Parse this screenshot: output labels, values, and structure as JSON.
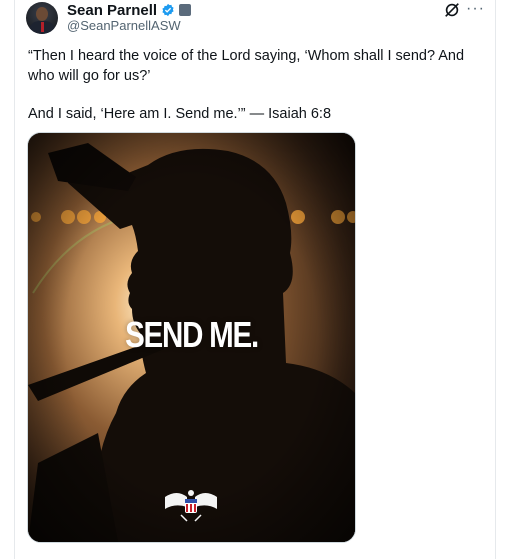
{
  "author": {
    "name": "Sean Parnell",
    "handle": "@SeanParnellASW",
    "verified_icon": "verified-badge-icon",
    "affiliation_icon": "affiliation-badge-icon"
  },
  "actions": {
    "grok_icon": "grok-icon",
    "more_icon": "more-options-icon",
    "more_glyph": "···"
  },
  "post": {
    "text_line1": "“Then I heard the voice of the Lord saying, ‘Whom shall I send? And who will go for us?’",
    "text_line2": "And I said, ‘Here am I. Send me.’” — Isaiah 6:8"
  },
  "media": {
    "overlay_text": "SEND ME.",
    "emblem_icon": "eagle-seal-icon"
  },
  "colors": {
    "verified": "#1d9bf0",
    "handle_gray": "#536471",
    "text": "#0f1419"
  }
}
